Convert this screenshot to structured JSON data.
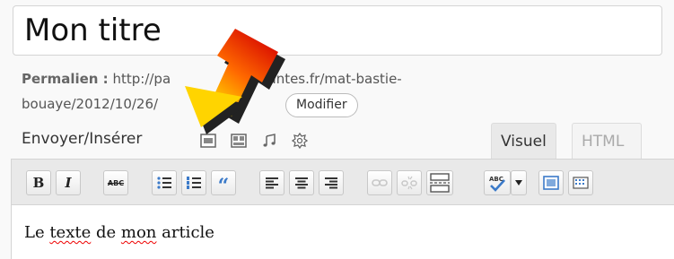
{
  "title": {
    "value": "Mon titre"
  },
  "permalink": {
    "label": "Permalien :",
    "url_line1": "http://pa",
    "url_line1_end": "e.ac-nantes.fr/mat-bastie-",
    "url_line2": "bouaye/2012/10/26/",
    "url_line2_end": "e/",
    "edit_button": "Modifier"
  },
  "media": {
    "label": "Envoyer/Insérer",
    "icons": [
      "image-upload-icon",
      "gallery-icon",
      "audio-icon",
      "media-gear-icon"
    ]
  },
  "tabs": {
    "visual": "Visuel",
    "html": "HTML"
  },
  "toolbar": {
    "bold": "B",
    "italic": "I",
    "strikethrough": "ABC",
    "blockquote": "“"
  },
  "editor": {
    "word1": "Le ",
    "word2": "texte",
    "word3": " de ",
    "word4": "mon",
    "word5": " article"
  },
  "colors": {
    "arrow_top": "#e00000",
    "arrow_bottom": "#ffd400",
    "tab_active": "#e9e9e9",
    "spellcheck": "#ee0000"
  }
}
